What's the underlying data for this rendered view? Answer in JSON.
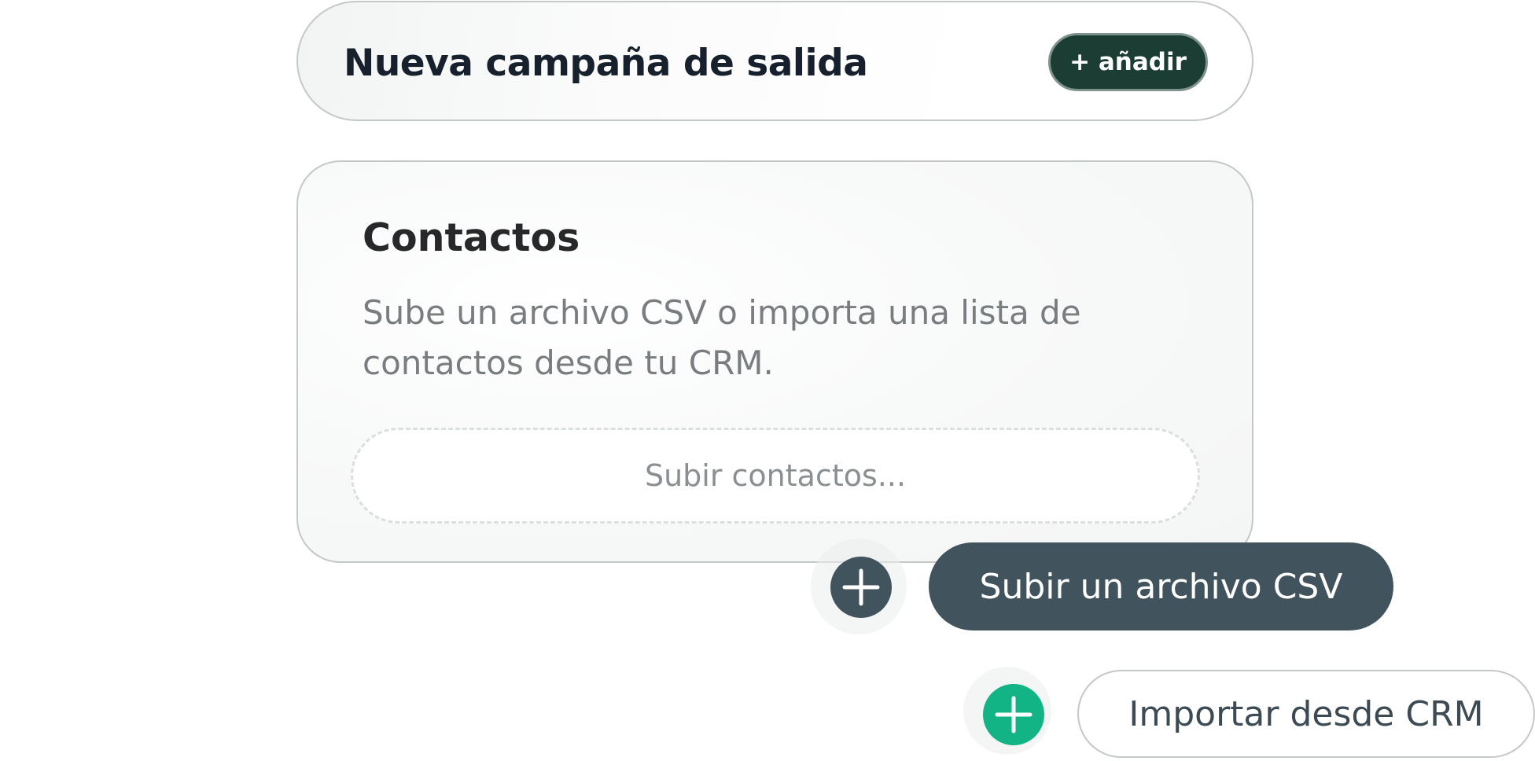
{
  "header": {
    "title": "Nueva campaña de salida",
    "add_label": "+ añadir"
  },
  "contacts": {
    "title": "Contactos",
    "description": "Sube un archivo CSV o importa una lista de contactos desde tu CRM.",
    "upload_placeholder": "Subir contactos..."
  },
  "actions": {
    "upload_csv_label": "Subir un archivo CSV",
    "import_crm_label": "Importar desde CRM",
    "upload_icon": "plus-icon",
    "import_icon": "plus-icon"
  },
  "colors": {
    "title_text": "#17202d",
    "add_button_bg": "#1b3d34",
    "csv_button_bg": "#41535d",
    "crm_plus_bg": "#12b385",
    "card_border": "#c4c9c8",
    "muted_text": "#7a7d80"
  }
}
